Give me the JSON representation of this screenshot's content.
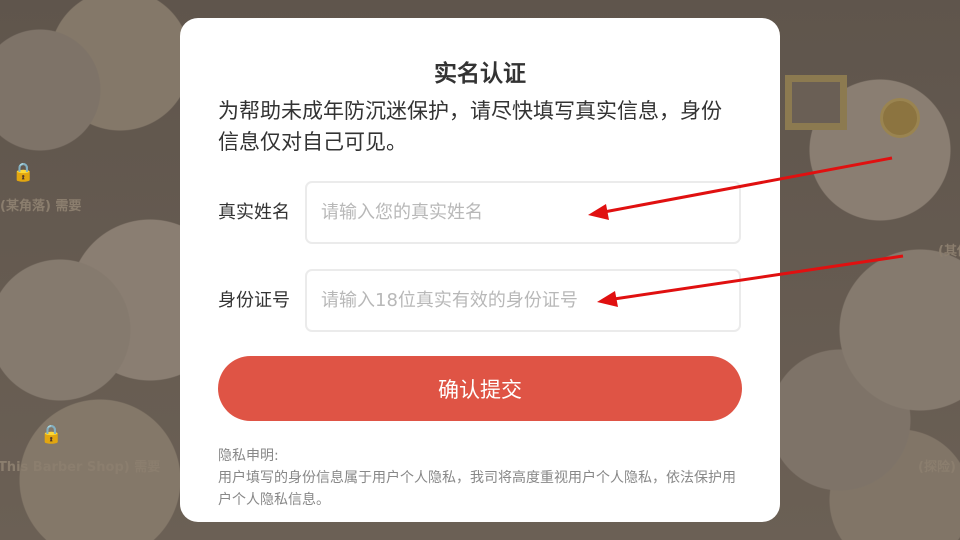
{
  "background": {
    "items": [
      {
        "label": "(某角落) 需要"
      },
      {
        "label": "(This Barber Shop) 需要"
      },
      {
        "label": "(其他)"
      },
      {
        "label": "(探险)"
      }
    ]
  },
  "dialog": {
    "title": "实名认证",
    "description": "为帮助未成年防沉迷保护，请尽快填写真实信息，身份信息仅对自己可见。",
    "name_field": {
      "label": "真实姓名",
      "placeholder": "请输入您的真实姓名",
      "value": ""
    },
    "id_field": {
      "label": "身份证号",
      "placeholder": "请输入18位真实有效的身份证号",
      "value": ""
    },
    "submit_label": "确认提交",
    "privacy": {
      "heading": "隐私申明:",
      "text": "用户填写的身份信息属于用户个人隐私，我司将高度重视用户个人隐私，依法保护用户个人隐私信息。"
    }
  },
  "colors": {
    "accent": "#df5445",
    "annotation_arrow": "#e01010",
    "overlay": "#6a5f55"
  }
}
